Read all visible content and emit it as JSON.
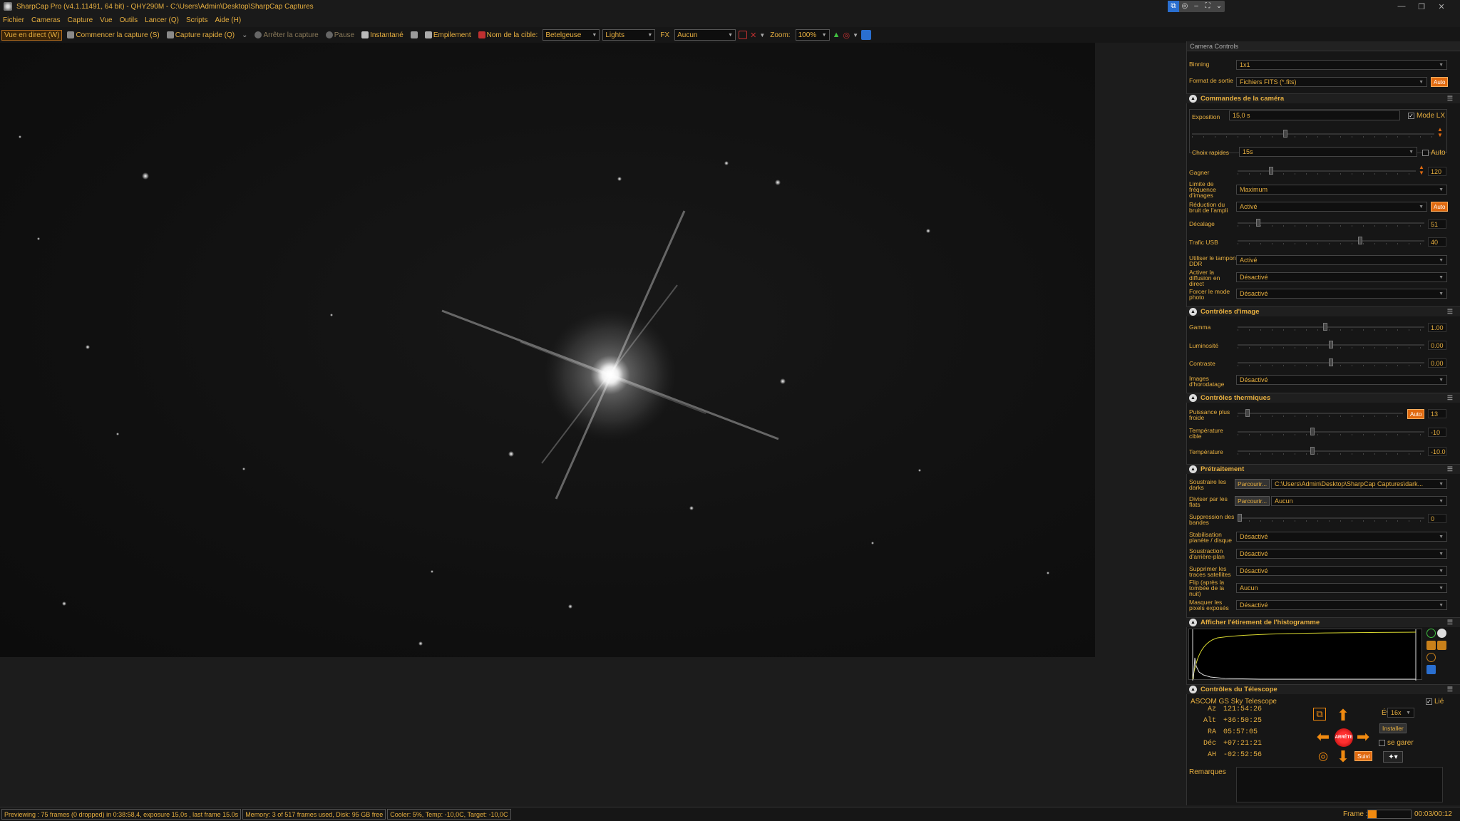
{
  "window": {
    "title": "SharpCap Pro (v4.1.11491, 64 bit) - QHY290M - C:\\Users\\Admin\\Desktop\\SharpCap Captures",
    "controls": [
      "—",
      "❐",
      "✕"
    ]
  },
  "menu": [
    "Fichier",
    "Cameras",
    "Capture",
    "Vue",
    "Outils",
    "Lancer (Q)",
    "Scripts",
    "Aide (H)"
  ],
  "toolbar": {
    "live_view": "Vue en direct (W)",
    "start_capture": "Commencer la capture (S)",
    "quick_capture": "Capture rapide (Q)",
    "stop_capture": "Arrêter la capture",
    "pause": "Pause",
    "snapshot": "Instantané",
    "stacking": "Empilement",
    "target_label": "Nom de la cible:",
    "target_value": "Betelgeuse",
    "frame_type": "Lights",
    "fx_label": "FX",
    "fx_value": "Aucun",
    "zoom_label": "Zoom:",
    "zoom_value": "100%"
  },
  "panel": {
    "title": "Camera Controls",
    "binning_label": "Binning",
    "binning_value": "1x1",
    "output_label": "Format de sortie",
    "output_value": "Fichiers FITS (*.fits)",
    "auto": "Auto",
    "camera_section": "Commandes de la caméra",
    "exposure_label": "Exposition",
    "exposure_value": "15,0 s",
    "lx_mode": "Mode LX",
    "quick_choice_label": "Choix rapides",
    "quick_choice_value": "15s",
    "quick_auto": "Auto",
    "gain_label": "Gagner",
    "gain_value": "120",
    "gain_level": 0.18,
    "framerate_label": "Limite de fréquence d'images",
    "framerate_value": "Maximum",
    "noise_label": "Réduction du bruit de l'ampli",
    "noise_value": "Activé",
    "offset_label": "Décalage",
    "offset_value": "51",
    "offset_level": 0.1,
    "usb_label": "Trafic USB",
    "usb_value": "40",
    "usb_level": 0.66,
    "ddr_label": "Utiliser le tampon DDR",
    "ddr_value": "Activé",
    "stream_label": "Activer la diffusion en direct",
    "stream_value": "Désactivé",
    "photo_label": "Forcer le mode photo",
    "photo_value": "Désactivé",
    "image_section": "Contrôles d'image",
    "gamma_label": "Gamma",
    "gamma_value": "1.00",
    "gamma_level": 0.47,
    "brightness_label": "Luminosité",
    "brightness_value": "0.00",
    "brightness_level": 0.5,
    "contrast_label": "Contraste",
    "contrast_value": "0.00",
    "contrast_level": 0.5,
    "timestamp_label": "Images d'horodatage",
    "timestamp_value": "Désactivé",
    "thermal_section": "Contrôles thermiques",
    "cooler_power_label": "Puissance plus froide",
    "cooler_power_value": "13",
    "cooler_power_level": 0.05,
    "target_temp_label": "Température cible",
    "target_temp_value": "-10",
    "target_temp_level": 0.4,
    "temp_label": "Température",
    "temp_value": "-10.0",
    "temp_level": 0.4,
    "preproc_section": "Prétraitement",
    "darks_label": "Soustraire les darks",
    "browse": "Parcourir...",
    "darks_value": "C:\\Users\\Admin\\Desktop\\SharpCap Captures\\dark...",
    "flats_label": "Diviser par les flats",
    "flats_value": "Aucun",
    "banding_label": "Suppression des bandes",
    "banding_value": "0",
    "stab_label": "Stabilisation planète / disque",
    "stab_value": "Désactivé",
    "bgsub_label": "Soustraction d'arrière-plan",
    "bgsub_value": "Désactivé",
    "sat_label": "Supprimer les traces satellites",
    "sat_value": "Désactivé",
    "flip_label": "Flip (après la tombée de la nuit)",
    "flip_value": "Aucun",
    "overexp_label": "Masquer les pixels exposés",
    "overexp_value": "Désactivé",
    "histo_section": "Afficher l'étirement de l'histogramme",
    "scope_section": "Contrôles du Télescope",
    "scope_name": "ASCOM GS Sky Telescope",
    "linked": "Lié",
    "coords": [
      {
        "k": "Az",
        "v": "121:54:26"
      },
      {
        "k": "Alt",
        "v": "+36:50:25"
      },
      {
        "k": "RA",
        "v": "05:57:05"
      },
      {
        "k": "Déc",
        "v": "+07:21:21"
      },
      {
        "k": "AH",
        "v": "-02:52:56"
      }
    ],
    "rate_label": "Évaluer:",
    "rate_value": "16x",
    "install": "Installer",
    "park": "se garer",
    "stop": "ARRÊTE",
    "track": "Suivi",
    "notes_label": "Remarques"
  },
  "status": {
    "preview": "Previewing : 75 frames (0 dropped) in 0:38:58,4, exposure 15,0s , last frame 15.0s",
    "memory": "Memory: 3 of 517 frames used, Disk: 95 GB free",
    "cooler": "Cooler: 5%, Temp: -10,0C, Target: -10,0C",
    "frame_label": "Frame :",
    "frame_progress": 0.2,
    "time": "00:03/00:12"
  },
  "colors": {
    "accent": "#e8b040",
    "auto": "#e06a10",
    "bg": "#161616"
  }
}
